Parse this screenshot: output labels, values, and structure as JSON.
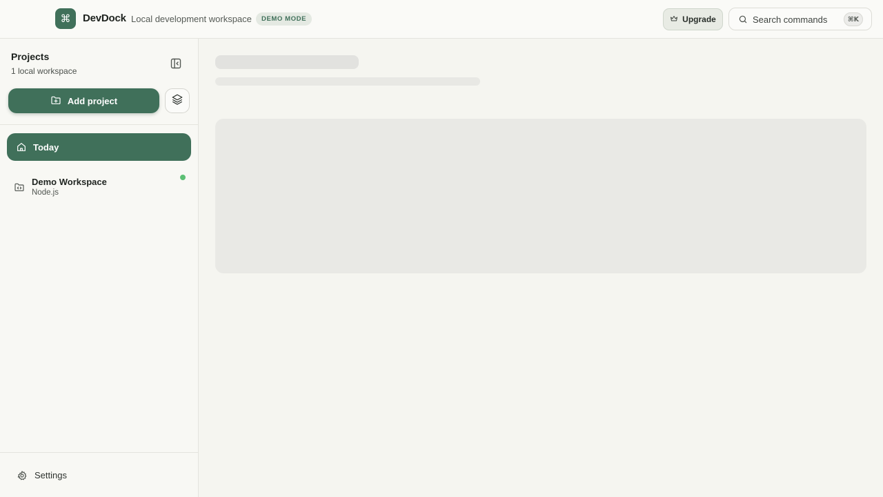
{
  "header": {
    "logo_glyph": "⌘",
    "app_title": "DevDock",
    "subtitle": "Local development workspace",
    "badge": "DEMO MODE",
    "upgrade_label": "Upgrade",
    "search_placeholder": "Search commands",
    "search_shortcut": "⌘K"
  },
  "sidebar": {
    "title": "Projects",
    "subtitle": "1 local workspace",
    "add_project_label": "Add project",
    "nav_items": [
      {
        "label": "Today",
        "icon": "home-icon",
        "active": true
      }
    ],
    "workspaces": [
      {
        "name": "Demo Workspace",
        "runtime": "Node.js",
        "status": "running",
        "status_color": "#5cbf74"
      }
    ],
    "settings_label": "Settings"
  },
  "main": {
    "state": "loading"
  },
  "colors": {
    "accent": "#40705a",
    "background": "#f5f5f0",
    "status_online": "#5cbf74"
  }
}
